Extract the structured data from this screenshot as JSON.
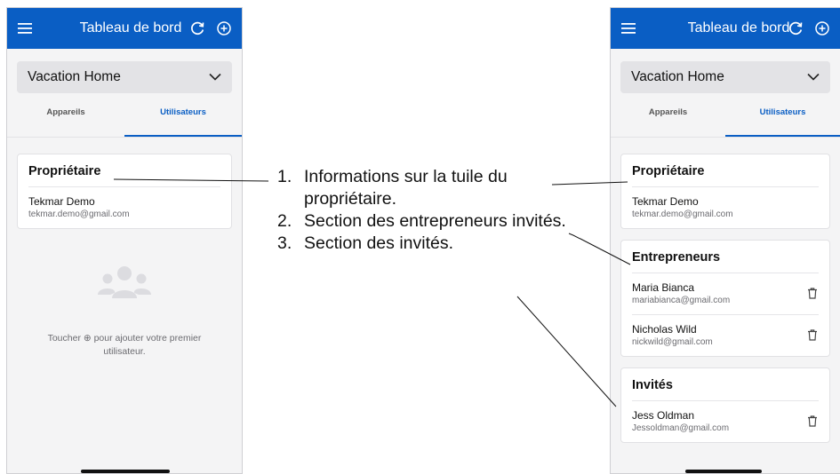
{
  "left_screen": {
    "topbar": {
      "title": "Tableau de bord"
    },
    "location": "Vacation Home",
    "tabs": [
      {
        "label": "Appareils"
      },
      {
        "label": "Utilisateurs"
      }
    ],
    "owner_card": {
      "title": "Propriétaire",
      "name": "Tekmar Demo",
      "email": "tekmar.demo@gmail.com"
    },
    "empty_state": {
      "text": "Toucher ⊕ pour ajouter votre premier utilisateur."
    }
  },
  "callouts": [
    {
      "number": "1.",
      "text": "Informations sur la tuile du propriétaire."
    },
    {
      "number": "2.",
      "text": "Section des entrepreneurs invités."
    },
    {
      "number": "3.",
      "text": "Section des invités."
    }
  ],
  "right_screen": {
    "topbar": {
      "title": "Tableau de bord"
    },
    "location": "Vacation Home",
    "tabs": [
      {
        "label": "Appareils"
      },
      {
        "label": "Utilisateurs"
      }
    ],
    "owner_card": {
      "title": "Propriétaire",
      "name": "Tekmar Demo",
      "email": "tekmar.demo@gmail.com"
    },
    "contractors_card": {
      "title": "Entrepreneurs",
      "users": [
        {
          "name": "Maria Bianca",
          "email": "mariabianca@gmail.com"
        },
        {
          "name": "Nicholas Wild",
          "email": "nickwild@gmail.com"
        }
      ]
    },
    "guests_card": {
      "title": "Invités",
      "users": [
        {
          "name": "Jess Oldman",
          "email": "Jessoldman@gmail.com"
        }
      ]
    }
  },
  "colors": {
    "brand_blue": "#0a5ec4",
    "background": "#f4f4f5"
  },
  "icons": [
    "menu-icon",
    "refresh-icon",
    "add-circle-icon",
    "chevron-down-icon",
    "users-group-icon",
    "trash-icon"
  ]
}
